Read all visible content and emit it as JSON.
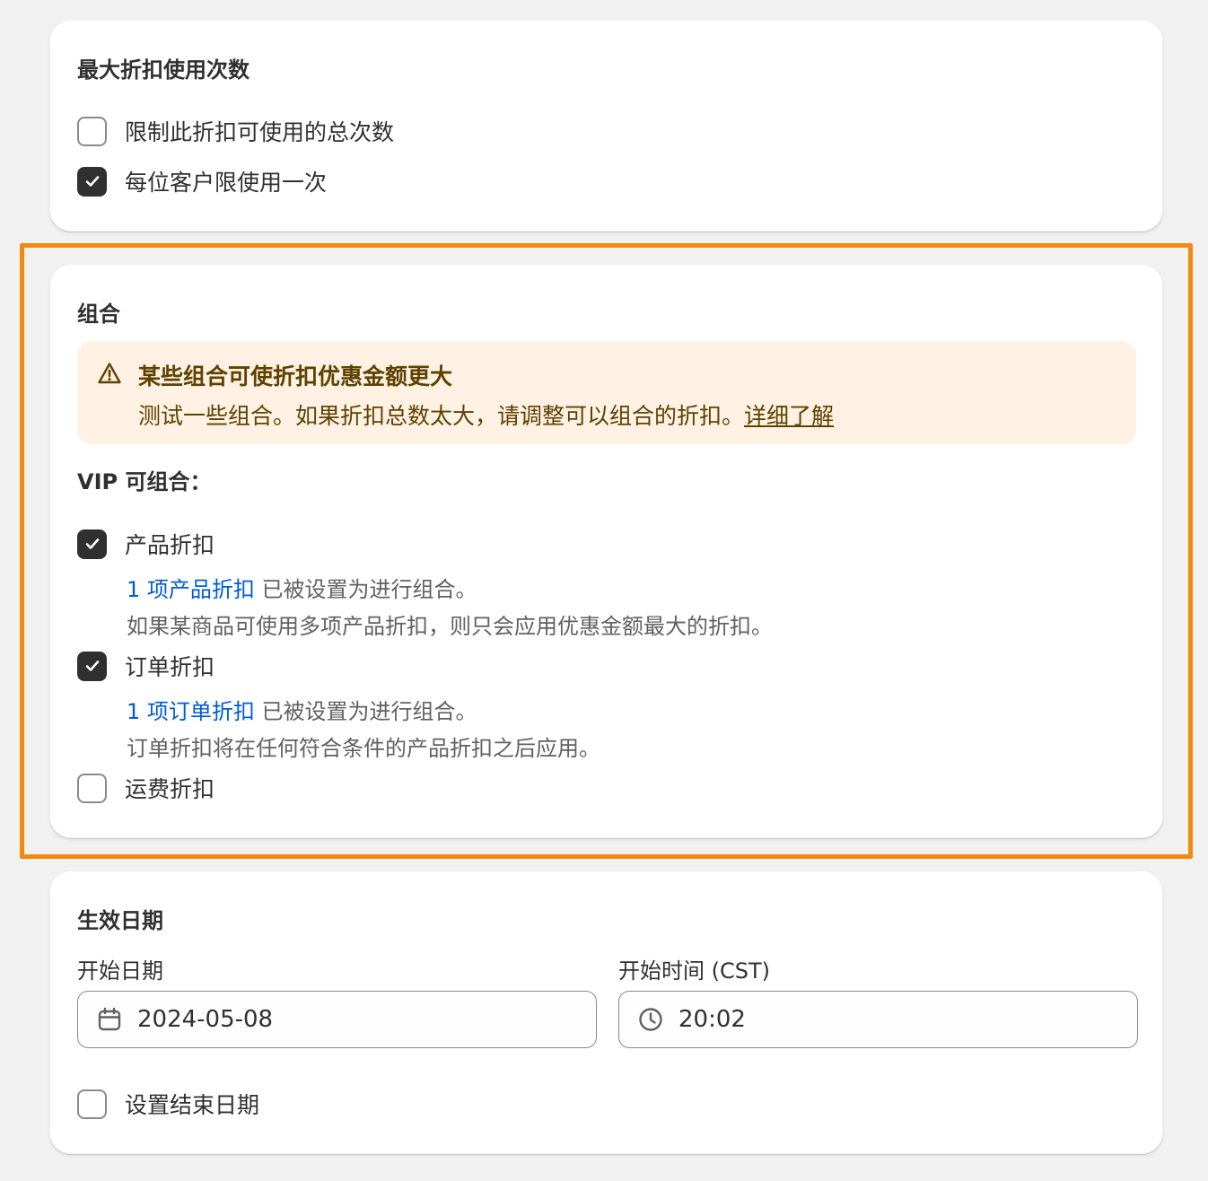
{
  "usage": {
    "title": "最大折扣使用次数",
    "options": [
      {
        "label": "限制此折扣可使用的总次数",
        "checked": false
      },
      {
        "label": "每位客户限使用一次",
        "checked": true
      }
    ]
  },
  "combo": {
    "title": "组合",
    "banner": {
      "icon": "warning-triangle-icon",
      "title": "某些组合可使折扣优惠金额更大",
      "body": "测试一些组合。如果折扣总数太大，请调整可以组合的折扣。",
      "link": "详细了解"
    },
    "heading": "VIP 可组合：",
    "options": [
      {
        "label": "产品折扣",
        "checked": true,
        "link": "1 项产品折扣",
        "link_suffix": " 已被设置为进行组合。",
        "note": "如果某商品可使用多项产品折扣，则只会应用优惠金额最大的折扣。"
      },
      {
        "label": "订单折扣",
        "checked": true,
        "link": "1 项订单折扣",
        "link_suffix": " 已被设置为进行组合。",
        "note": "订单折扣将在任何符合条件的产品折扣之后应用。"
      },
      {
        "label": "运费折扣",
        "checked": false
      }
    ]
  },
  "active_dates": {
    "title": "生效日期",
    "start_date": {
      "label": "开始日期",
      "value": "2024-05-08",
      "icon": "calendar-icon"
    },
    "start_time": {
      "label": "开始时间 (CST)",
      "value": "20:02",
      "icon": "clock-icon"
    },
    "end_date_option": {
      "label": "设置结束日期",
      "checked": false
    }
  },
  "colors": {
    "highlight": "#f28a0c",
    "link": "#005bd3",
    "banner_bg": "#fff1e3",
    "banner_text": "#5e4200"
  }
}
